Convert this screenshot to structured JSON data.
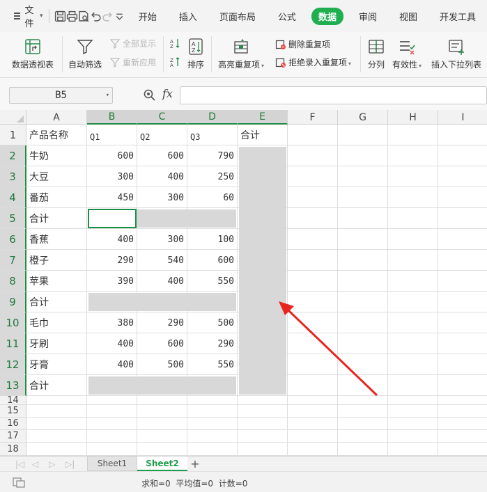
{
  "menubar": {
    "file_label": "文件",
    "tabs": [
      {
        "label": "开始"
      },
      {
        "label": "插入"
      },
      {
        "label": "页面布局"
      },
      {
        "label": "公式"
      },
      {
        "label": "数据",
        "active": true
      },
      {
        "label": "审阅"
      },
      {
        "label": "视图"
      },
      {
        "label": "开发工具"
      }
    ],
    "active_tab_color": "#1faf50"
  },
  "ribbon": {
    "pivot_table": "数据透视表",
    "auto_filter": "自动筛选",
    "show_all": "全部显示",
    "reapply": "重新应用",
    "sort": "排序",
    "highlight_duplicates": "高亮重复项",
    "remove_duplicates": "删除重复项",
    "reject_duplicate_entry": "拒绝录入重复项",
    "split_column": "分列",
    "validity": "有效性",
    "insert_dropdown": "插入下拉列表"
  },
  "formula_bar": {
    "name_box": "B5",
    "fx_label": "fx",
    "formula_value": ""
  },
  "sheet": {
    "columns": [
      "A",
      "B",
      "C",
      "D",
      "E",
      "F",
      "G",
      "H",
      "I"
    ],
    "selected_columns": [
      "B",
      "C",
      "D",
      "E"
    ],
    "rows": [
      "1",
      "2",
      "3",
      "4",
      "5",
      "6",
      "7",
      "8",
      "9",
      "10",
      "11",
      "12",
      "13",
      "14",
      "15",
      "16",
      "17",
      "18"
    ],
    "header": [
      "产品名称",
      "Q1",
      "Q2",
      "Q3",
      "合计"
    ],
    "data": [
      [
        "牛奶",
        "600",
        "600",
        "790",
        ""
      ],
      [
        "大豆",
        "300",
        "400",
        "250",
        ""
      ],
      [
        "番茄",
        "450",
        "300",
        "60",
        ""
      ],
      [
        "合计",
        "",
        "",
        "",
        ""
      ],
      [
        "香蕉",
        "400",
        "300",
        "100",
        ""
      ],
      [
        "橙子",
        "290",
        "540",
        "600",
        ""
      ],
      [
        "苹果",
        "390",
        "400",
        "550",
        ""
      ],
      [
        "合计",
        "",
        "",
        "",
        ""
      ],
      [
        "毛巾",
        "380",
        "290",
        "500",
        ""
      ],
      [
        "牙刷",
        "400",
        "600",
        "290",
        ""
      ],
      [
        "牙膏",
        "400",
        "500",
        "550",
        ""
      ],
      [
        "合计",
        "",
        "",
        "",
        ""
      ]
    ],
    "active_cell": "B5"
  },
  "sheet_tabs": [
    {
      "label": "Sheet1",
      "active": false
    },
    {
      "label": "Sheet2",
      "active": true
    }
  ],
  "add_sheet_label": "+",
  "status_bar": {
    "sum_text": "求和=0",
    "avg_text": "平均值=0",
    "count_text": "计数=0"
  },
  "colors": {
    "accent_green": "#1faf50",
    "selection_fill": "#d8d8d8",
    "arrow_red": "#e8251f"
  }
}
